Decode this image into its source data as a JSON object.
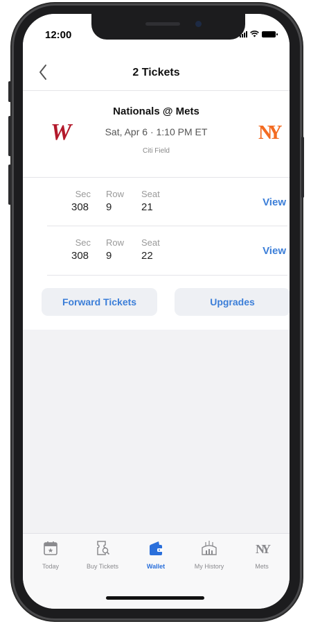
{
  "status_bar": {
    "time": "12:00"
  },
  "nav": {
    "back_icon": "chevron-left-icon",
    "title": "2 Tickets"
  },
  "game": {
    "title": "Nationals @ Mets",
    "date_time": "Sat, Apr 6  ·  1:10 PM ET",
    "venue": "Citi Field",
    "away_logo": "W",
    "home_logo": "NY"
  },
  "tickets": {
    "headers": {
      "sec": "Sec",
      "row": "Row",
      "seat": "Seat"
    },
    "view_label": "View",
    "rows": [
      {
        "sec": "308",
        "row": "9",
        "seat": "21"
      },
      {
        "sec": "308",
        "row": "9",
        "seat": "22"
      }
    ]
  },
  "actions": {
    "forward": "Forward Tickets",
    "upgrades": "Upgrades"
  },
  "tabbar": {
    "items": [
      {
        "label": "Today",
        "icon": "calendar-star-icon",
        "active": false
      },
      {
        "label": "Buy Tickets",
        "icon": "ticket-search-icon",
        "active": false
      },
      {
        "label": "Wallet",
        "icon": "wallet-icon",
        "active": true
      },
      {
        "label": "My History",
        "icon": "stadium-icon",
        "active": false
      },
      {
        "label": "Mets",
        "icon": "mets-logo-icon",
        "active": false
      }
    ]
  },
  "colors": {
    "accent": "#3b7ed8",
    "nationals_red": "#b3192b",
    "mets_orange": "#f36b21"
  }
}
